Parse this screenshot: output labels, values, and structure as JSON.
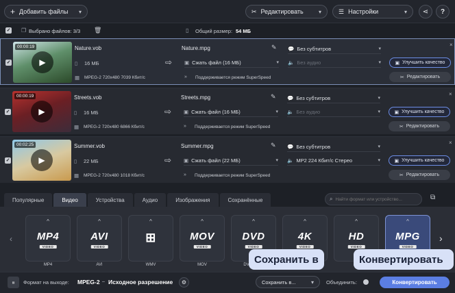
{
  "topbar": {
    "add_files_label": "Добавить файлы",
    "edit_label": "Редактировать",
    "settings_label": "Настройки",
    "help_label": "?"
  },
  "selection": {
    "selected_label": "Выбрано файлов: 3/3",
    "total_label": "Общий размер:",
    "total_value": "54 МБ"
  },
  "files": [
    {
      "duration": "00:00:19",
      "source_name": "Nature.vob",
      "size": "16 МБ",
      "source_info": "MPEG-2 720x480 7039 Кбит/с",
      "output_name": "Nature.mpg",
      "compress": "Сжать файл (16 МБ)",
      "superspeed": "Поддерживается режим SuperSpeed",
      "subtitles": "Без субтитров",
      "audio": "Без аудио",
      "audio_disabled": true,
      "enhance_label": "Улучшить качество",
      "edit_label": "Редактировать",
      "selected": true
    },
    {
      "duration": "00:00:19",
      "source_name": "Streets.vob",
      "size": "16 МБ",
      "source_info": "MPEG-2 720x480 6866 Кбит/с",
      "output_name": "Streets.mpg",
      "compress": "Сжать файл (16 МБ)",
      "superspeed": "Поддерживается режим SuperSpeed",
      "subtitles": "Без субтитров",
      "audio": "Без аудио",
      "audio_disabled": true,
      "enhance_label": "Улучшить качество",
      "edit_label": "Редактировать",
      "selected": false
    },
    {
      "duration": "00:02:25",
      "source_name": "Summer.vob",
      "size": "22 МБ",
      "source_info": "MPEG-2 720x480 1018 Кбит/с",
      "output_name": "Summer.mpg",
      "compress": "Сжать файл (22 МБ)",
      "superspeed": "Поддерживается режим SuperSpeed",
      "subtitles": "Без субтитров",
      "audio": "MP2 224 Кбит/с Стерео",
      "audio_disabled": false,
      "enhance_label": "Улучшить качество",
      "edit_label": "Редактировать",
      "selected": false
    }
  ],
  "tabs": [
    "Популярные",
    "Видео",
    "Устройства",
    "Аудио",
    "Изображения",
    "Сохранённые"
  ],
  "active_tab": "Видео",
  "search_placeholder": "Найти формат или устройство...",
  "formats": [
    {
      "logo": "MP4",
      "label": "MP4"
    },
    {
      "logo": "AVI",
      "label": "AVI"
    },
    {
      "logo": "WIN",
      "label": "WMV"
    },
    {
      "logo": "MOV",
      "label": "MOV"
    },
    {
      "logo": "DVD",
      "label": "DVD-сов..."
    },
    {
      "logo": "4K",
      "label": ""
    },
    {
      "logo": "HD",
      "label": "HD"
    },
    {
      "logo": "MPG",
      "label": ""
    }
  ],
  "bottom": {
    "output_format_label": "Формат на выходе:",
    "output_format_value": "MPEG-2",
    "resolution_label": "Исходное разрешение",
    "save_to_label": "Сохранить в...",
    "merge_label": "Объединить:",
    "convert_label": "Конвертировать"
  },
  "tooltips": {
    "save_tip": "Сохранить в",
    "convert_tip": "Конвертировать"
  }
}
